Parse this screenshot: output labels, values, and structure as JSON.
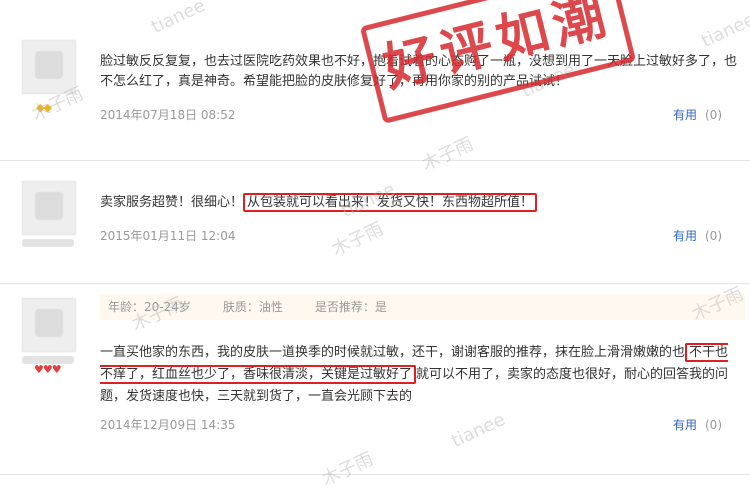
{
  "reviews": [
    {
      "text": "脸过敏反反复复，也去过医院吃药效果也不好，抱着试着的心态购了一瓶，没想到用了一天脸上过敏好多了，也不怎么红了，真是神奇。希望能把脸的皮肤修复好了，再用你家的别的产品试试！",
      "date": "2014年07月18日 08:52",
      "useful_label": "有用",
      "useful_count": "(0)",
      "rank_icon": "diamond-gold"
    },
    {
      "text_before": "卖家服务超赞！很细心！",
      "text_highlight": "从包装就可以看出来！发货又快！东西物超所值！",
      "date": "2015年01月11日 12:04",
      "useful_label": "有用",
      "useful_count": "(0)"
    },
    {
      "attrs": {
        "age": "年龄：20-24岁",
        "skin": "肤质：油性",
        "recommend": "是否推荐：是"
      },
      "text_line1": "一直买他家的东西，我的皮肤一道换季的时候就过敏，还干，谢谢客服的推荐，抹在脸上滑滑嫩嫩的也",
      "text_highlight": "不干也不痒了，红血丝也少了，香味很清淡，关键是过敏好了",
      "text_after": "就可以不用了，卖家的态度也很好，耐心的回答我的问题，发货速度也快，三天就到货了，一直会光顾下去的",
      "date": "2014年12月09日 14:35",
      "useful_label": "有用",
      "useful_count": "(0)",
      "rank_icon": "heart-red"
    }
  ],
  "stamp_text": "好评如潮",
  "watermarks": [
    "tianee",
    "木子雨"
  ],
  "colors": {
    "highlight": "#e02020",
    "stamp": "#d7282d",
    "link": "#3366cc"
  }
}
